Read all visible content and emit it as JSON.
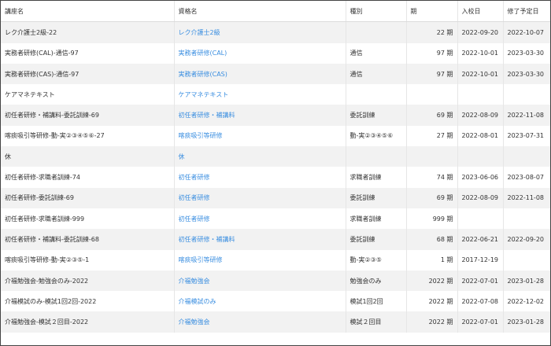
{
  "colors": {
    "link": "#3a8ee0",
    "stripe": "#f2f2f2"
  },
  "columns": [
    "講座名",
    "資格名",
    "種別",
    "期",
    "入校日",
    "修了予定日"
  ],
  "rows": [
    [
      "レク介護士2級-22",
      "レク介護士2級",
      "",
      "22 期",
      "2022-09-20",
      "2022-10-07"
    ],
    [
      "実務者研修(CAL)-通信-97",
      "実務者研修(CAL)",
      "通信",
      "97 期",
      "2022-10-01",
      "2023-03-30"
    ],
    [
      "実務者研修(CAS)-通信-97",
      "実務者研修(CAS)",
      "通信",
      "97 期",
      "2022-10-01",
      "2023-03-30"
    ],
    [
      "ケアマネテキスト",
      "ケアマネテキスト",
      "",
      "",
      "",
      ""
    ],
    [
      "初任者研修・補講料-委託訓練-69",
      "初任者研修・補講料",
      "委託訓練",
      "69 期",
      "2022-08-09",
      "2022-11-08"
    ],
    [
      "喀痰吸引等研修-動-実②③④⑤⑥-27",
      "喀痰吸引等研修",
      "動-実②③④⑤⑥",
      "27 期",
      "2022-08-01",
      "2023-07-31"
    ],
    [
      "休",
      "休",
      "",
      "",
      "",
      ""
    ],
    [
      "初任者研修-求職者訓練-74",
      "初任者研修",
      "求職者訓練",
      "74 期",
      "2023-06-06",
      "2023-08-07"
    ],
    [
      "初任者研修-委託訓練-69",
      "初任者研修",
      "委託訓練",
      "69 期",
      "2022-08-09",
      "2022-11-08"
    ],
    [
      "初任者研修-求職者訓練-999",
      "初任者研修",
      "求職者訓練",
      "999 期",
      "",
      ""
    ],
    [
      "初任者研修・補講料-委託訓練-68",
      "初任者研修・補講料",
      "委託訓練",
      "68 期",
      "2022-06-21",
      "2022-09-20"
    ],
    [
      "喀痰吸引等研修-動-実②③⑤-1",
      "喀痰吸引等研修",
      "動-実②③⑤",
      "1 期",
      "2017-12-19",
      ""
    ],
    [
      "介福勉強会-勉強会のみ-2022",
      "介福勉強会",
      "勉強会のみ",
      "2022 期",
      "2022-07-01",
      "2023-01-28"
    ],
    [
      "介福模試のみ-模試1回2回-2022",
      "介福模試のみ",
      "模試1回2回",
      "2022 期",
      "2022-07-08",
      "2022-12-02"
    ],
    [
      "介福勉強会-模試２回目-2022",
      "介福勉強会",
      "模試２回目",
      "2022 期",
      "2022-07-01",
      "2023-01-28"
    ]
  ]
}
